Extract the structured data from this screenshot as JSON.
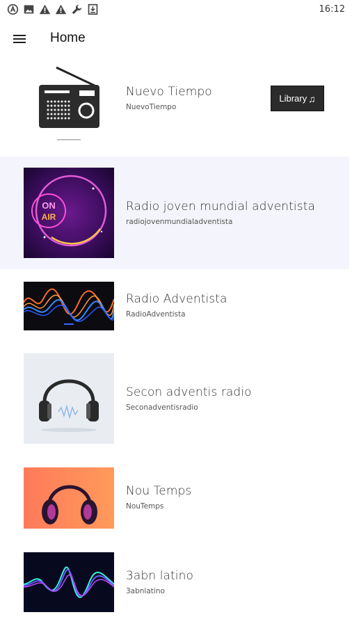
{
  "status_bar": {
    "time": "16:12",
    "icons": [
      "autofill-a-icon",
      "image-icon",
      "warning-icon",
      "warning-icon",
      "wrench-icon",
      "download-box-icon"
    ]
  },
  "app_bar": {
    "title": "Home",
    "menu_icon": "hamburger-menu-icon"
  },
  "featured": {
    "name": "Nuevo Tiempo",
    "slug": "NuevoTiempo",
    "library_label": "Library",
    "library_icon": "music-note-icon"
  },
  "stations": [
    {
      "name": "Radio joven mundial adventista",
      "slug": "radiojovenmundialadventista",
      "selected": true
    },
    {
      "name": "Radio Adventista",
      "slug": "RadioAdventista"
    },
    {
      "name": "Secon adventis radio",
      "slug": "Seconadventisradio"
    },
    {
      "name": "Nou Temps",
      "slug": "NouTemps"
    },
    {
      "name": "3abn latino",
      "slug": "3abnlatino"
    }
  ],
  "colors": {
    "selected_row": "#f4f5fc",
    "library_bg": "#2b2b2b"
  }
}
